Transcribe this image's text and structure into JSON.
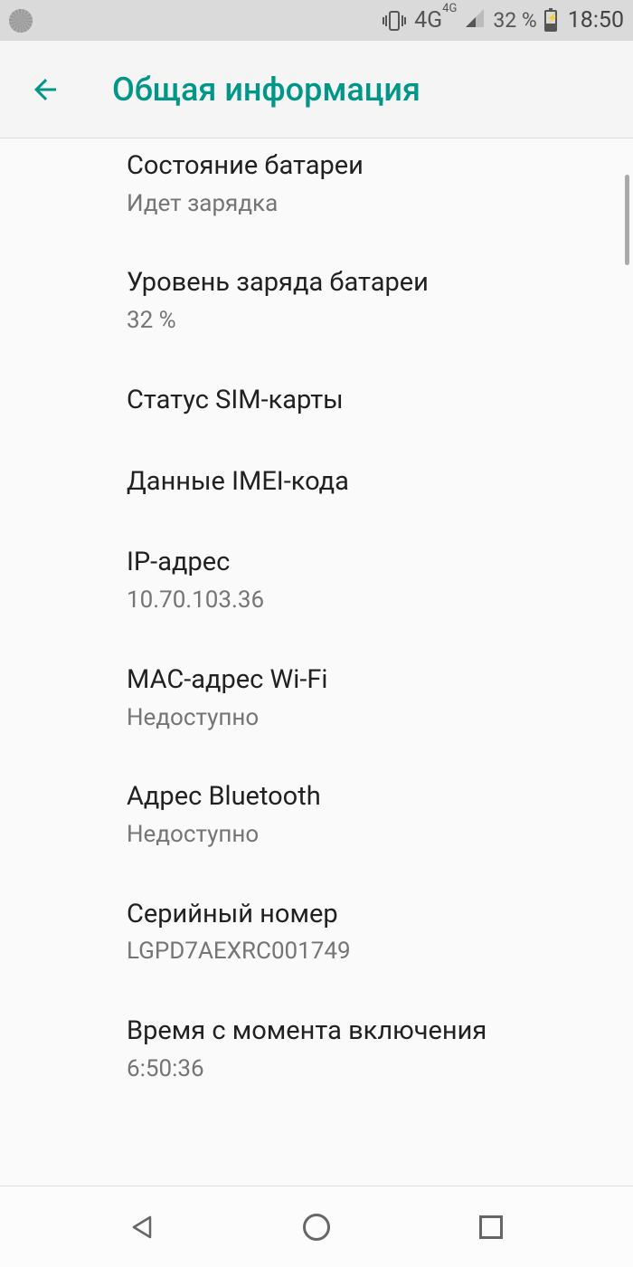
{
  "status_bar": {
    "network_label": "4G",
    "network_sup": "4G",
    "battery_percent": "32 %",
    "clock": "18:50"
  },
  "header": {
    "title": "Общая информация"
  },
  "items": [
    {
      "title": "Состояние батареи",
      "value": "Идет зарядка"
    },
    {
      "title": "Уровень заряда батареи",
      "value": "32 %"
    },
    {
      "title": "Статус SIM-карты",
      "value": null
    },
    {
      "title": "Данные IMEI-кода",
      "value": null
    },
    {
      "title": "IP-адрес",
      "value": "10.70.103.36"
    },
    {
      "title": "MAC-адрес Wi-Fi",
      "value": "Недоступно"
    },
    {
      "title": "Адрес Bluetooth",
      "value": "Недоступно"
    },
    {
      "title": "Серийный номер",
      "value": "LGPD7AEXRC001749"
    },
    {
      "title": "Время с момента включения",
      "value": "6:50:36"
    }
  ],
  "colors": {
    "accent": "#009688"
  }
}
